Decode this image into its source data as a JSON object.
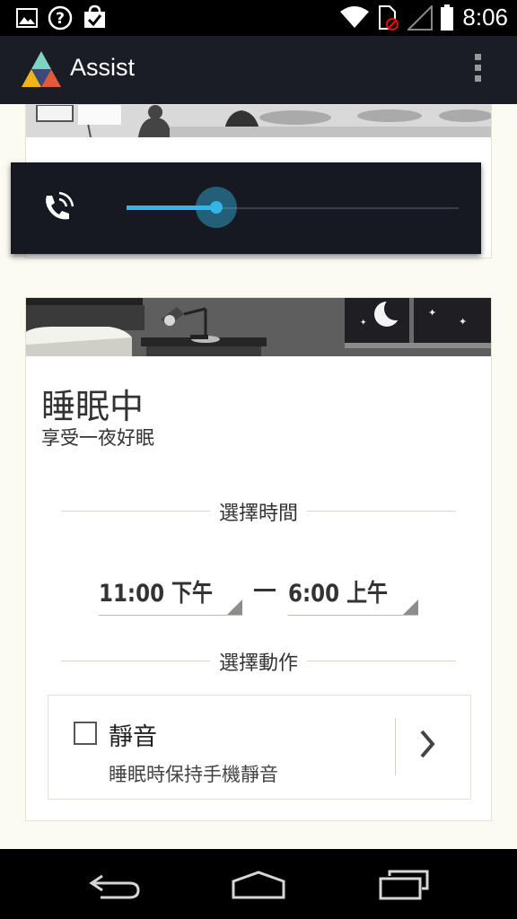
{
  "status_bar": {
    "time": "8:06",
    "icons": [
      "image-icon",
      "help-circle-icon",
      "shopping-bag-check-icon",
      "wifi-icon",
      "sim-error-icon",
      "signal-icon",
      "battery-icon"
    ]
  },
  "action_bar": {
    "app_title": "Assist",
    "overflow_icon": "overflow-menu-icon"
  },
  "volume_overlay": {
    "icon": "phone-ringer-icon",
    "level": 0.27,
    "accent": "#33b5e5"
  },
  "sleep_card": {
    "title": "睡眠中",
    "subtitle": "享受一夜好眠",
    "time_section_label": "選擇時間",
    "start_time": "11:00 下午",
    "end_time": "6:00 上午",
    "action_section_label": "選擇動作",
    "action": {
      "title": "靜音",
      "description": "睡眠時保持手機靜音",
      "checked": false
    }
  },
  "nav_bar": {
    "icons": [
      "back-icon",
      "home-icon",
      "recents-icon"
    ]
  },
  "colors": {
    "status_bar": "#000000",
    "action_bar": "#1b1d26",
    "background": "#fbfbf2",
    "accent": "#33b5e5"
  }
}
